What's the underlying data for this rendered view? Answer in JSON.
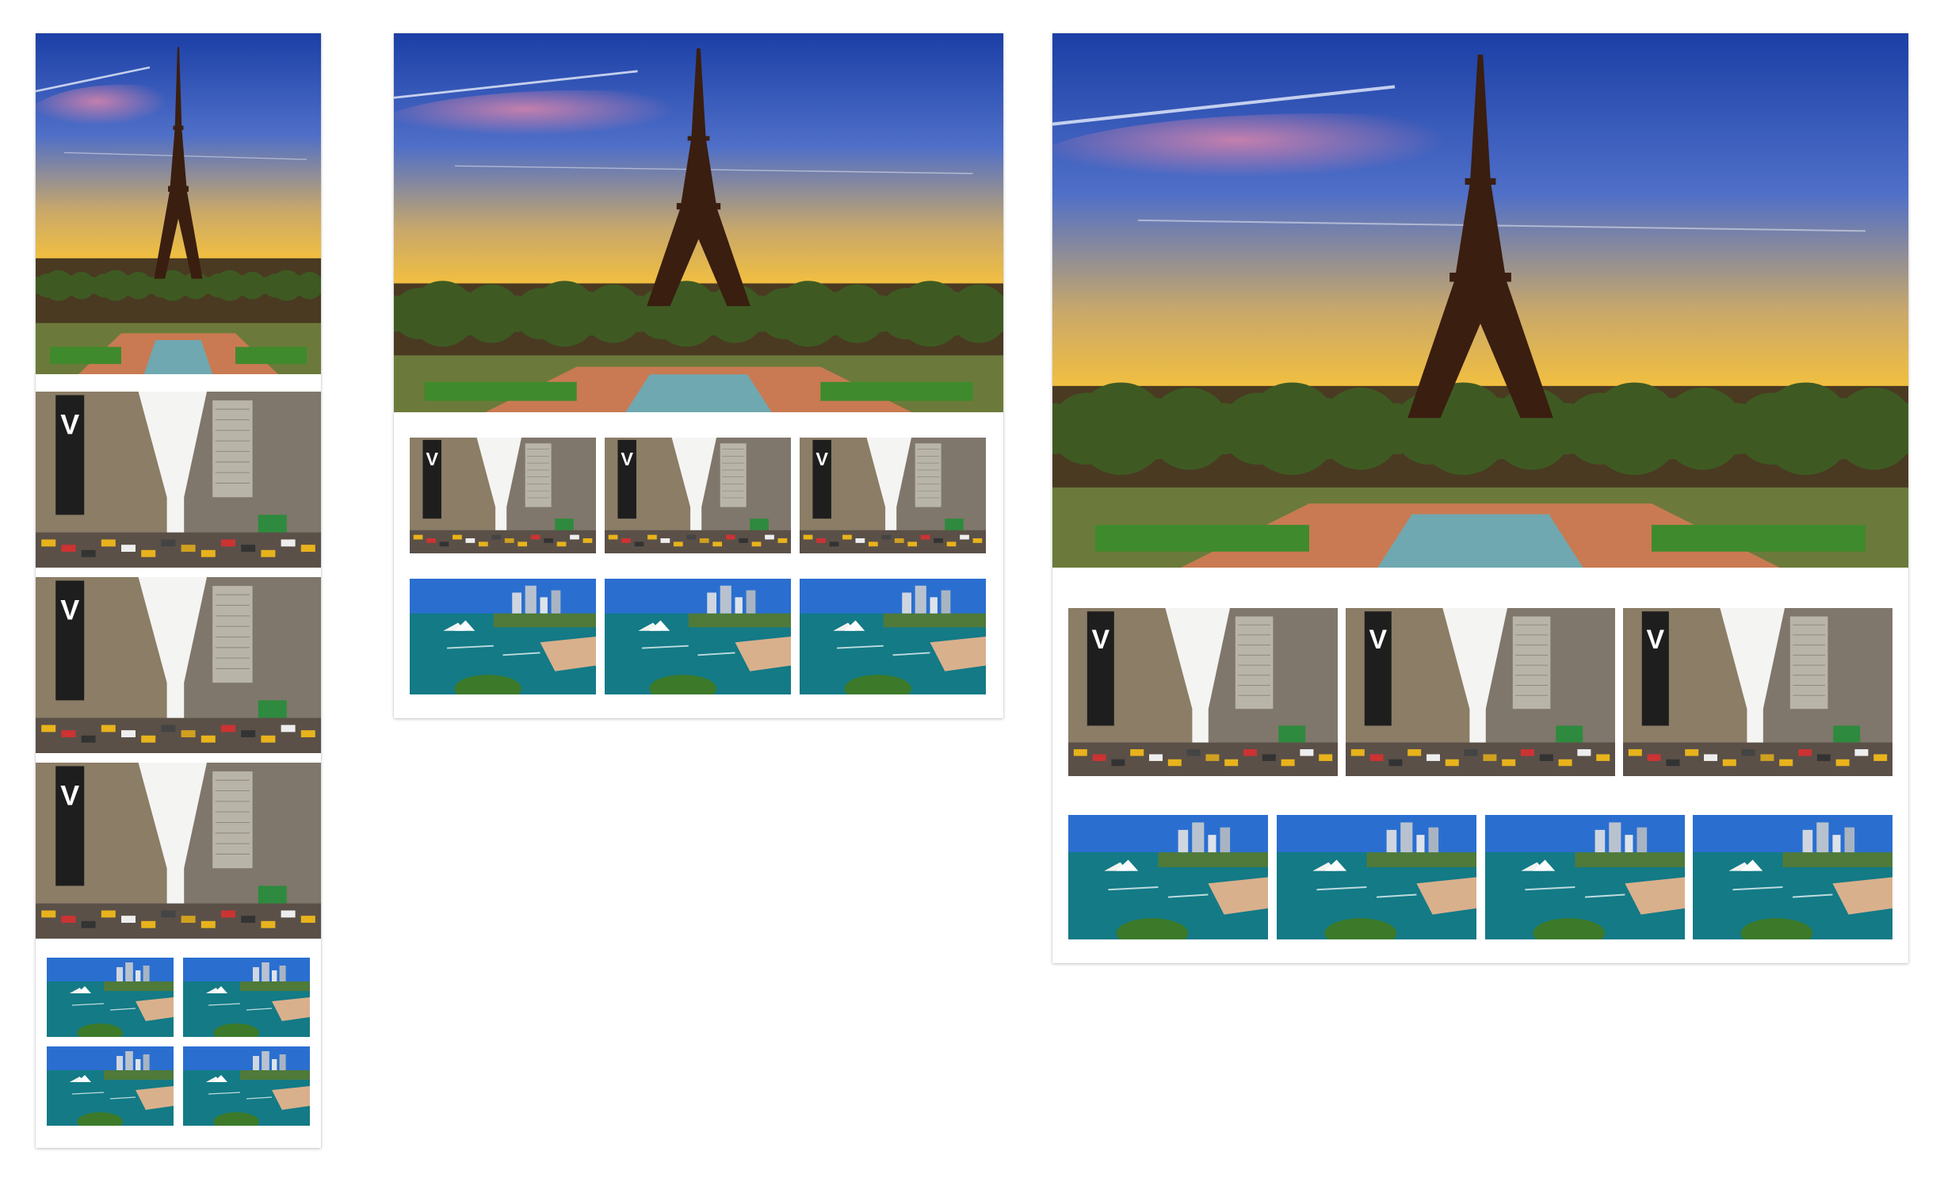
{
  "layouts": [
    {
      "id": "layout-a",
      "hero": "eiffel-tower-sunset",
      "street_photos": [
        "new-york-street",
        "new-york-street",
        "new-york-street"
      ],
      "harbor_photos": [
        "sydney-harbour",
        "sydney-harbour",
        "sydney-harbour",
        "sydney-harbour"
      ]
    },
    {
      "id": "layout-b",
      "hero": "eiffel-tower-sunset",
      "street_photos": [
        "new-york-street",
        "new-york-street",
        "new-york-street"
      ],
      "harbor_photos": [
        "sydney-harbour",
        "sydney-harbour",
        "sydney-harbour"
      ]
    },
    {
      "id": "layout-c",
      "hero": "eiffel-tower-sunset",
      "street_photos": [
        "new-york-street",
        "new-york-street",
        "new-york-street"
      ],
      "harbor_photos": [
        "sydney-harbour",
        "sydney-harbour",
        "sydney-harbour",
        "sydney-harbour"
      ]
    }
  ],
  "street_banner_letter": "V",
  "colors": {
    "sky_top": "#1b3fa6",
    "sky_mid": "#4f6fc8",
    "sunset_glow": "#f7c23a",
    "horizon": "#f58a1e",
    "tower": "#3a1e10",
    "trees": "#3e5a22",
    "harbor_water": "#137a86",
    "harbor_sky": "#2a6fd0"
  }
}
